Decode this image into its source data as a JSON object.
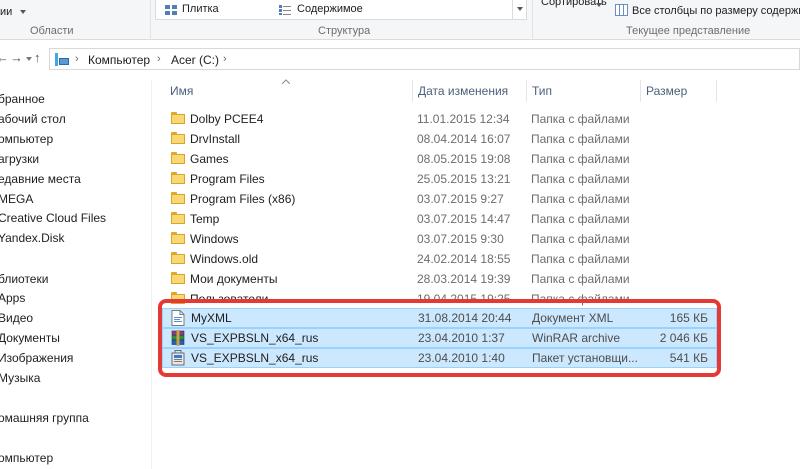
{
  "ribbon": {
    "view_small_label": "ии",
    "tile_label": "Плитка",
    "content_label": "Содержимое",
    "sort_label": "Сортировать",
    "fit_columns_label": "Все столбцы по размеру содержимого",
    "group_areas": "Области",
    "group_structure": "Структура",
    "group_current_view": "Текущее представление"
  },
  "address": {
    "back": "←",
    "forward": "→",
    "up": "↑",
    "crumbs": [
      "Компьютер",
      "Acer (C:)"
    ]
  },
  "sidebar": {
    "items": [
      "бранное",
      "абочий стол",
      "омпьютер",
      "агрузки",
      "едавние места",
      "MEGA",
      "Creative Cloud Files",
      "Yandex.Disk",
      "блиотеки",
      "Apps",
      "Видео",
      "Документы",
      "Изображения",
      "Музыка",
      "омашняя группа",
      "омпьютер"
    ]
  },
  "columns": {
    "name": "Имя",
    "date": "Дата изменения",
    "type": "Тип",
    "size": "Размер"
  },
  "files": [
    {
      "name": "Dolby PCEE4",
      "date": "11.01.2015 12:34",
      "type": "Папка с файлами",
      "size": "",
      "icon": "folder-icon"
    },
    {
      "name": "DrvInstall",
      "date": "08.04.2014 16:07",
      "type": "Папка с файлами",
      "size": "",
      "icon": "folder-icon"
    },
    {
      "name": "Games",
      "date": "08.05.2015 19:08",
      "type": "Папка с файлами",
      "size": "",
      "icon": "folder-icon"
    },
    {
      "name": "Program Files",
      "date": "25.05.2015 13:21",
      "type": "Папка с файлами",
      "size": "",
      "icon": "folder-icon"
    },
    {
      "name": "Program Files (x86)",
      "date": "03.07.2015 9:27",
      "type": "Папка с файлами",
      "size": "",
      "icon": "folder-icon"
    },
    {
      "name": "Temp",
      "date": "03.07.2015 14:47",
      "type": "Папка с файлами",
      "size": "",
      "icon": "folder-icon"
    },
    {
      "name": "Windows",
      "date": "03.07.2015 9:30",
      "type": "Папка с файлами",
      "size": "",
      "icon": "folder-icon"
    },
    {
      "name": "Windows.old",
      "date": "24.02.2014 18:55",
      "type": "Папка с файлами",
      "size": "",
      "icon": "folder-icon"
    },
    {
      "name": "Мои документы",
      "date": "28.03.2014 19:39",
      "type": "Папка с файлами",
      "size": "",
      "icon": "folder-icon"
    },
    {
      "name": "Пользователи",
      "date": "19.04.2015 19:25",
      "type": "Папка с файлами",
      "size": "",
      "icon": "folder-icon"
    },
    {
      "name": "MyXML",
      "date": "31.08.2014 20:44",
      "type": "Документ XML",
      "size": "165 КБ",
      "icon": "xml-file-icon"
    },
    {
      "name": "VS_EXPBSLN_x64_rus",
      "date": "23.04.2010 1:37",
      "type": "WinRAR archive",
      "size": "2 046 КБ",
      "icon": "winrar-archive-icon"
    },
    {
      "name": "VS_EXPBSLN_x64_rus",
      "date": "23.04.2010 1:40",
      "type": "Пакет установщи...",
      "size": "541 КБ",
      "icon": "installer-package-icon"
    }
  ],
  "colors": {
    "selection_bg": "#cce8ff",
    "selection_border": "#99d1ff",
    "highlight_border": "#e53935",
    "folder": "#f8d775"
  }
}
